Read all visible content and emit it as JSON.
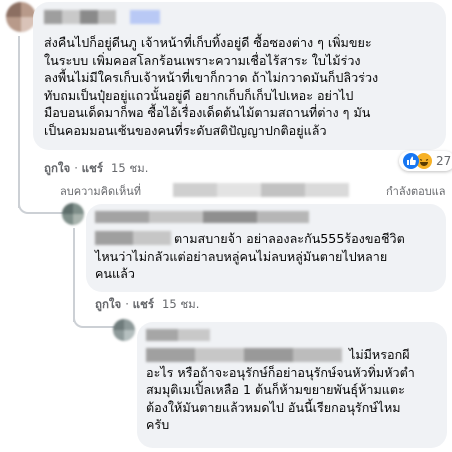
{
  "comment1": {
    "text_lines": [
      "ส่งคืนไปก็อยู่ดีนภู เจ้าหน้าที่เก็บทิ้งอยู่ดี ซื้อซองต่าง ๆ เพิ่มขยะ",
      "ในระบบ เพิ่มคอสโลกร้อนเพราะความเชื่อไร้สาระ ใบไม้ร่วง",
      "ลงพื้นไม่มีใครเก็บเจ้าหน้าที่เขาก็กวาด ถ้าไม่กวาดมันก็ปลิวร่วง",
      "ทับถมเป็นปุ๋ยอยู่แถวนั้นอยู่ดี อยากเก็บก็เก็บไปเหอะ อย่าไป",
      "มือบอนเด็ดมาก็พอ ซื้อไอ้เรื่องเด็ดต้นไม้ตามสถานที่ต่าง ๆ มัน",
      "เป็นคอมมอนเซ้นของคนที่ระดับสติปัญญาปกติอยู่แล้ว"
    ],
    "reaction_count": "27",
    "like_label": "ถูกใจ",
    "share_label": "แชร์",
    "time": "15 ชม."
  },
  "deleted_notice": {
    "left": "ลบความคิดเห็นที่",
    "right": "กำลังตอบแล"
  },
  "reply1": {
    "text_lines": [
      "ตามสบายจ้า อย่าลองละกัน555ร้องขอชีวิต",
      "ไหนว่าไม่กลัวแต่อย่าลบหลู่คนไม่ลบหลู่มันตายไปหลาย",
      "คนแล้ว"
    ],
    "like_label": "ถูกใจ",
    "share_label": "แชร์",
    "time": "15 ชม."
  },
  "reply2": {
    "text_lines": [
      "ไม่มีหรอกผี",
      "อะไร หรือถ้าจะอนุรักษ์ก็อย่าอนุรักษ์จนหัวทิ่มหัวตำ",
      "สมมุติเมเปิ้ลเหลือ 1 ต้นก็ห้ามขยายพันธุ์ห้ามแตะ",
      "ต้องให้มันตายแล้วหมดไป อันนี้เรียกอนุรักษ์ไหม",
      "ครับ"
    ]
  },
  "colors": {
    "bubble": "#f0f2f5",
    "meta_text": "#65676b",
    "like_blue": "#1877f2",
    "haha_yellow": "#f7b125"
  }
}
